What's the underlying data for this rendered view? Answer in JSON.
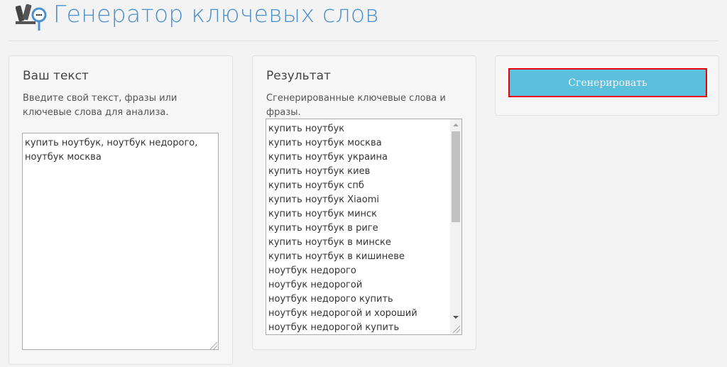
{
  "header": {
    "title": "Генератор ключевых слов",
    "logo_icon": "keyword-tools-magnifier-icon"
  },
  "input_panel": {
    "heading": "Ваш текст",
    "description": "Введите свой текст, фразы или ключевые слова для анализа.",
    "value": "купить ноутбук, ноутбук недорого, ноутбук москва"
  },
  "result_panel": {
    "heading": "Результат",
    "description": "Сгенерированные ключевые слова и фразы.",
    "items": [
      "купить ноутбук",
      "купить ноутбук москва",
      "купить ноутбук украина",
      "купить ноутбук киев",
      "купить ноутбук спб",
      "купить ноутбук Xiaomi",
      "купить ноутбук минск",
      "купить ноутбук в риге",
      "купить ноутбук в минске",
      "купить ноутбук в кишиневе",
      "ноутбук недорого",
      "ноутбук недорогой",
      "ноутбук недорого купить",
      "ноутбук недорогой и хороший",
      "ноутбук недорогой купить"
    ]
  },
  "action_panel": {
    "generate_label": "Сгенерировать"
  },
  "colors": {
    "accent": "#4a90d0",
    "button": "#5bc0de",
    "highlight": "#ee0000"
  }
}
